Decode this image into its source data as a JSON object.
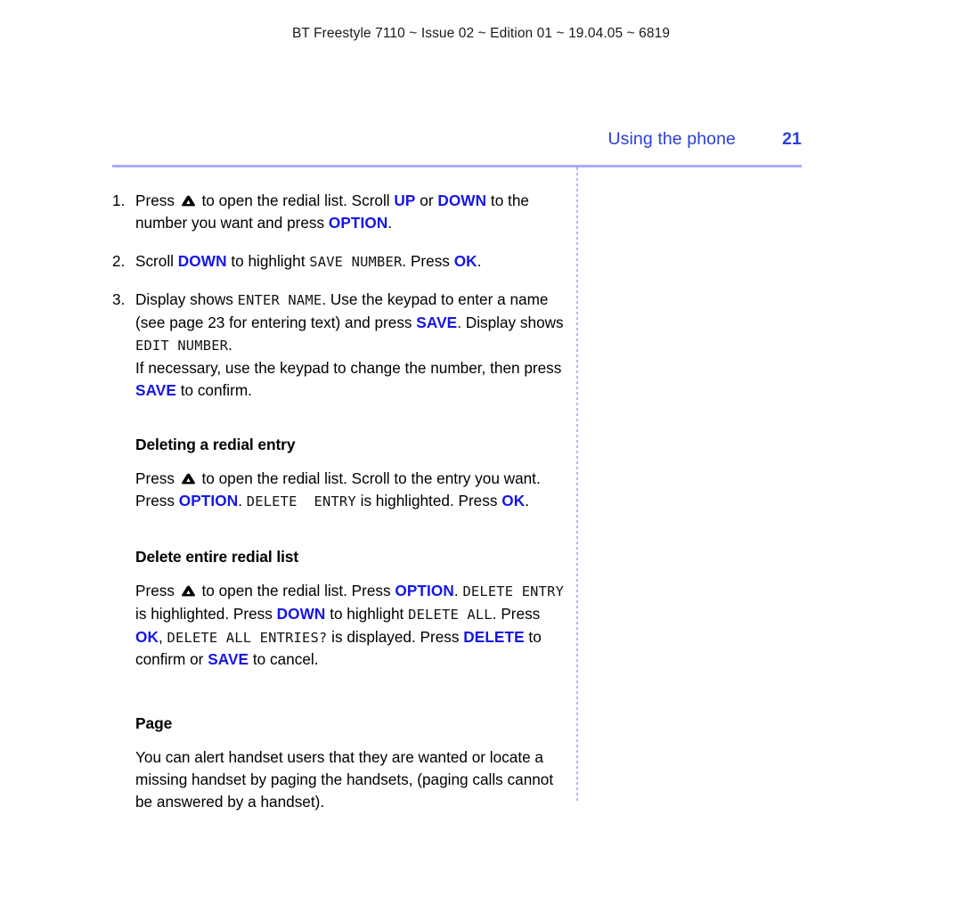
{
  "imprint": "BT Freestyle 7110 ~ Issue 02 ~ Edition 01 ~ 19.04.05 ~ 6819",
  "running_head": {
    "title": "Using the phone",
    "page_number": "21"
  },
  "colors": {
    "keyword_blue": "#1616e8",
    "header_blue": "#2b3fd8",
    "rule_periwinkle": "#a9abf7",
    "text_black": "#000000"
  },
  "icons": {
    "redial_key": "up-triangle-key-icon"
  },
  "steps": [
    {
      "number": "1.",
      "parts": [
        {
          "t": "text",
          "v": "Press "
        },
        {
          "t": "icon",
          "v": "up-triangle-key-icon"
        },
        {
          "t": "text",
          "v": " to open the redial list. Scroll "
        },
        {
          "t": "kw",
          "v": "UP"
        },
        {
          "t": "text",
          "v": " or "
        },
        {
          "t": "kw",
          "v": "DOWN"
        },
        {
          "t": "text",
          "v": " to the number you want and press "
        },
        {
          "t": "kw",
          "v": "OPTION"
        },
        {
          "t": "text",
          "v": "."
        }
      ]
    },
    {
      "number": "2.",
      "parts": [
        {
          "t": "text",
          "v": "Scroll "
        },
        {
          "t": "kw",
          "v": "DOWN"
        },
        {
          "t": "text",
          "v": " to highlight "
        },
        {
          "t": "lcd",
          "v": "SAVE NUMBER"
        },
        {
          "t": "text",
          "v": ". Press "
        },
        {
          "t": "kw",
          "v": "OK"
        },
        {
          "t": "text",
          "v": "."
        }
      ]
    },
    {
      "number": "3.",
      "parts": [
        {
          "t": "text",
          "v": "Display shows "
        },
        {
          "t": "lcd",
          "v": "ENTER NAME"
        },
        {
          "t": "text",
          "v": ". Use the keypad to enter a name (see page 23 for entering text) and press "
        },
        {
          "t": "kw",
          "v": "SAVE"
        },
        {
          "t": "text",
          "v": ". Display shows "
        },
        {
          "t": "lcd",
          "v": "EDIT NUMBER"
        },
        {
          "t": "text",
          "v": "."
        },
        {
          "t": "br",
          "v": ""
        },
        {
          "t": "text",
          "v": "If necessary, use the keypad to change the number, then press "
        },
        {
          "t": "kw",
          "v": "SAVE"
        },
        {
          "t": "text",
          "v": " to confirm."
        }
      ]
    }
  ],
  "sections": [
    {
      "heading": "Deleting a redial entry",
      "parts": [
        {
          "t": "text",
          "v": "Press "
        },
        {
          "t": "icon",
          "v": "up-triangle-key-icon"
        },
        {
          "t": "text",
          "v": " to open the redial list. Scroll to the entry you want. Press "
        },
        {
          "t": "kw",
          "v": "OPTION"
        },
        {
          "t": "text",
          "v": ". "
        },
        {
          "t": "lcd",
          "v": "DELETE  ENTRY"
        },
        {
          "t": "text",
          "v": " is highlighted. Press "
        },
        {
          "t": "kw",
          "v": "OK"
        },
        {
          "t": "text",
          "v": "."
        }
      ]
    },
    {
      "heading": "Delete entire redial list",
      "parts": [
        {
          "t": "text",
          "v": "Press "
        },
        {
          "t": "icon",
          "v": "up-triangle-key-icon"
        },
        {
          "t": "text",
          "v": " to open the redial list. Press "
        },
        {
          "t": "kw",
          "v": "OPTION"
        },
        {
          "t": "text",
          "v": ". "
        },
        {
          "t": "lcd",
          "v": "DELETE ENTRY"
        },
        {
          "t": "text",
          "v": " is highlighted. Press "
        },
        {
          "t": "kw",
          "v": "DOWN"
        },
        {
          "t": "text",
          "v": " to highlight "
        },
        {
          "t": "lcd",
          "v": "DELETE ALL"
        },
        {
          "t": "text",
          "v": ". Press "
        },
        {
          "t": "kw",
          "v": "OK"
        },
        {
          "t": "text",
          "v": ", "
        },
        {
          "t": "lcd",
          "v": "DELETE ALL ENTRIES?"
        },
        {
          "t": "text",
          "v": " is displayed. Press "
        },
        {
          "t": "kw",
          "v": "DELETE"
        },
        {
          "t": "text",
          "v": " to confirm or "
        },
        {
          "t": "kw",
          "v": "SAVE"
        },
        {
          "t": "text",
          "v": " to cancel."
        }
      ]
    },
    {
      "heading": "Page",
      "parts": [
        {
          "t": "text",
          "v": "You can alert handset users that they are wanted or locate a missing handset by paging the handsets, (paging calls cannot be answered by a handset)."
        }
      ]
    }
  ]
}
